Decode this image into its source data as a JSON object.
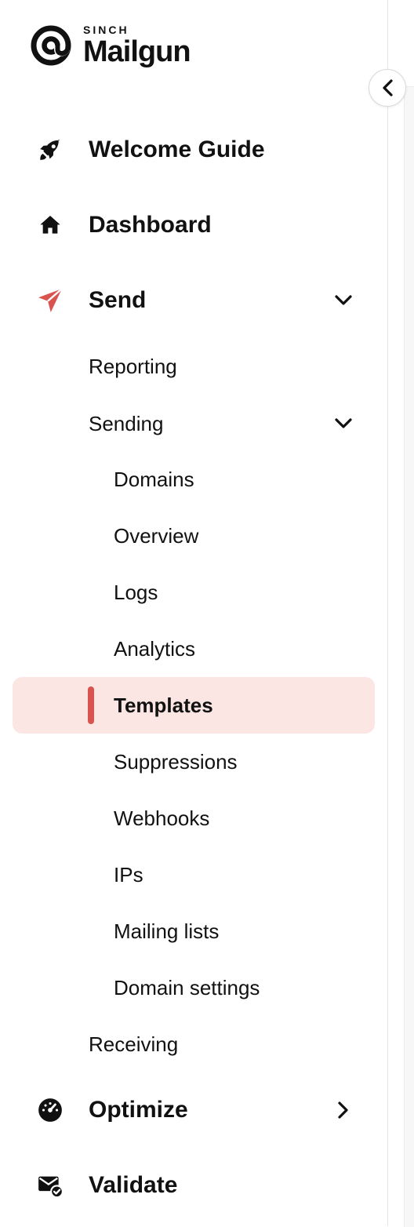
{
  "brand": {
    "sinch": "SINCH",
    "name": "Mailgun",
    "accent_color": "#d9534f",
    "active_bg_color": "#fbe6e4"
  },
  "controls": {
    "collapse_icon": "chevron-left-icon"
  },
  "nav": {
    "welcome": {
      "label": "Welcome Guide",
      "icon": "rocket-icon"
    },
    "dashboard": {
      "label": "Dashboard",
      "icon": "home-icon"
    },
    "send": {
      "label": "Send",
      "icon": "paper-plane-icon",
      "expanded": true,
      "reporting": {
        "label": "Reporting"
      },
      "sending": {
        "label": "Sending",
        "expanded": true,
        "items": [
          {
            "label": "Domains"
          },
          {
            "label": "Overview"
          },
          {
            "label": "Logs"
          },
          {
            "label": "Analytics"
          },
          {
            "label": "Templates",
            "active": true
          },
          {
            "label": "Suppressions"
          },
          {
            "label": "Webhooks"
          },
          {
            "label": "IPs"
          },
          {
            "label": "Mailing lists"
          },
          {
            "label": "Domain settings"
          }
        ]
      },
      "receiving": {
        "label": "Receiving"
      }
    },
    "optimize": {
      "label": "Optimize",
      "icon": "gauge-icon",
      "expanded": false
    },
    "validate": {
      "label": "Validate",
      "icon": "mail-check-icon"
    }
  }
}
